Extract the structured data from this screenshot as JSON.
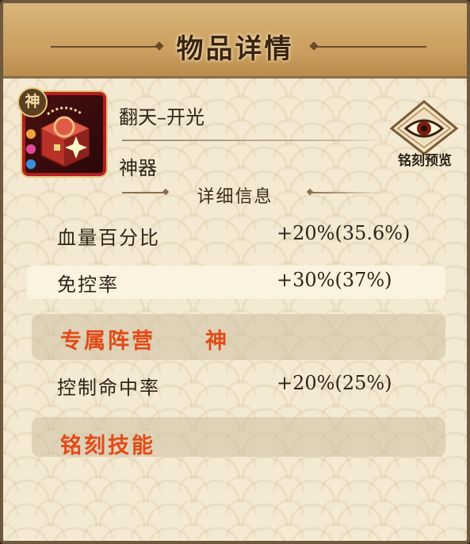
{
  "header": {
    "title": "物品详情"
  },
  "item": {
    "tier_badge": "神",
    "name": "翻天–开光",
    "type": "神器",
    "icon": "red-treasure-box-icon",
    "gems": [
      "#f2a23a",
      "#e04a9a",
      "#3a8fe0"
    ]
  },
  "inscribe_preview": {
    "label": "铭刻预览",
    "icon": "eye-icon"
  },
  "details": {
    "title": "详细信息",
    "stats": [
      {
        "label": "血量百分比",
        "value": "+20%(35.6%)"
      },
      {
        "label": "免控率",
        "value": "+30%(37%)"
      }
    ],
    "faction": {
      "label": "专属阵营",
      "value": "神"
    },
    "stats2": [
      {
        "label": "控制命中率",
        "value": "+20%(25%)"
      }
    ],
    "skill": {
      "label": "铭刻技能"
    }
  },
  "colors": {
    "accent_red": "#e24a17",
    "frame_red": "#b11f1f",
    "header_gold": "#c99d5d"
  }
}
